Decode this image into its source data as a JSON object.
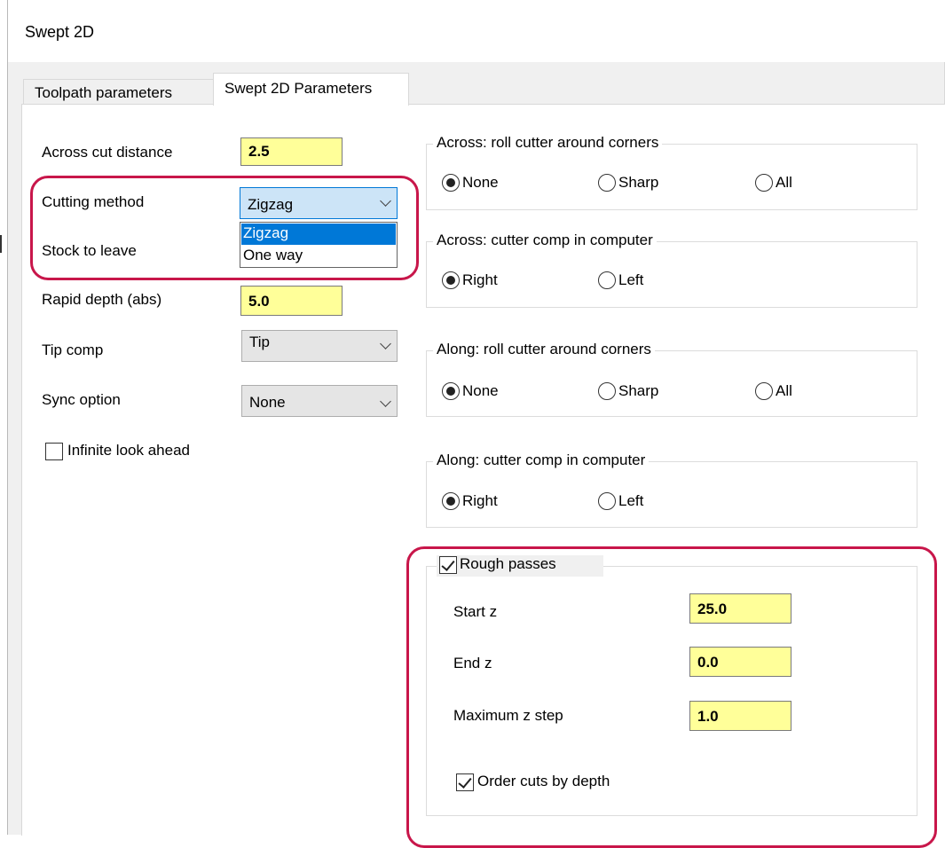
{
  "window": {
    "title": "Swept 2D"
  },
  "tabs": [
    {
      "label": "Toolpath parameters",
      "active": false
    },
    {
      "label": "Swept 2D Parameters",
      "active": true
    }
  ],
  "left": {
    "across_cut_distance": {
      "label": "Across cut distance",
      "value": "2.5"
    },
    "cutting_method": {
      "label": "Cutting method",
      "value": "Zigzag",
      "options": [
        "Zigzag",
        "One way"
      ],
      "highlighted_option": "Zigzag"
    },
    "stock_to_leave": {
      "label": "Stock to leave"
    },
    "rapid_depth": {
      "label": "Rapid depth (abs)",
      "value": "5.0"
    },
    "tip_comp": {
      "label": "Tip comp",
      "value": "Tip"
    },
    "sync_option": {
      "label": "Sync option",
      "value": "None"
    },
    "infinite_look_ahead": {
      "label": "Infinite look ahead",
      "checked": false
    }
  },
  "groups": {
    "across_roll": {
      "title": "Across: roll cutter around corners",
      "options": [
        "None",
        "Sharp",
        "All"
      ],
      "selected": "None"
    },
    "across_comp": {
      "title": "Across: cutter comp in computer",
      "options": [
        "Right",
        "Left"
      ],
      "selected": "Right"
    },
    "along_roll": {
      "title": "Along: roll cutter around corners",
      "options": [
        "None",
        "Sharp",
        "All"
      ],
      "selected": "None"
    },
    "along_comp": {
      "title": "Along: cutter comp in computer",
      "options": [
        "Right",
        "Left"
      ],
      "selected": "Right"
    }
  },
  "rough_passes": {
    "label": "Rough passes",
    "checked": true,
    "start_z": {
      "label": "Start z",
      "value": "25.0"
    },
    "end_z": {
      "label": "End z",
      "value": "0.0"
    },
    "max_z_step": {
      "label": "Maximum z step",
      "value": "1.0"
    },
    "order_cuts_by_depth": {
      "label": "Order cuts by depth",
      "checked": true
    }
  },
  "colors": {
    "input_highlight": "#ffff99",
    "annotation_outline": "#c8164a",
    "selection": "#0078d7"
  }
}
